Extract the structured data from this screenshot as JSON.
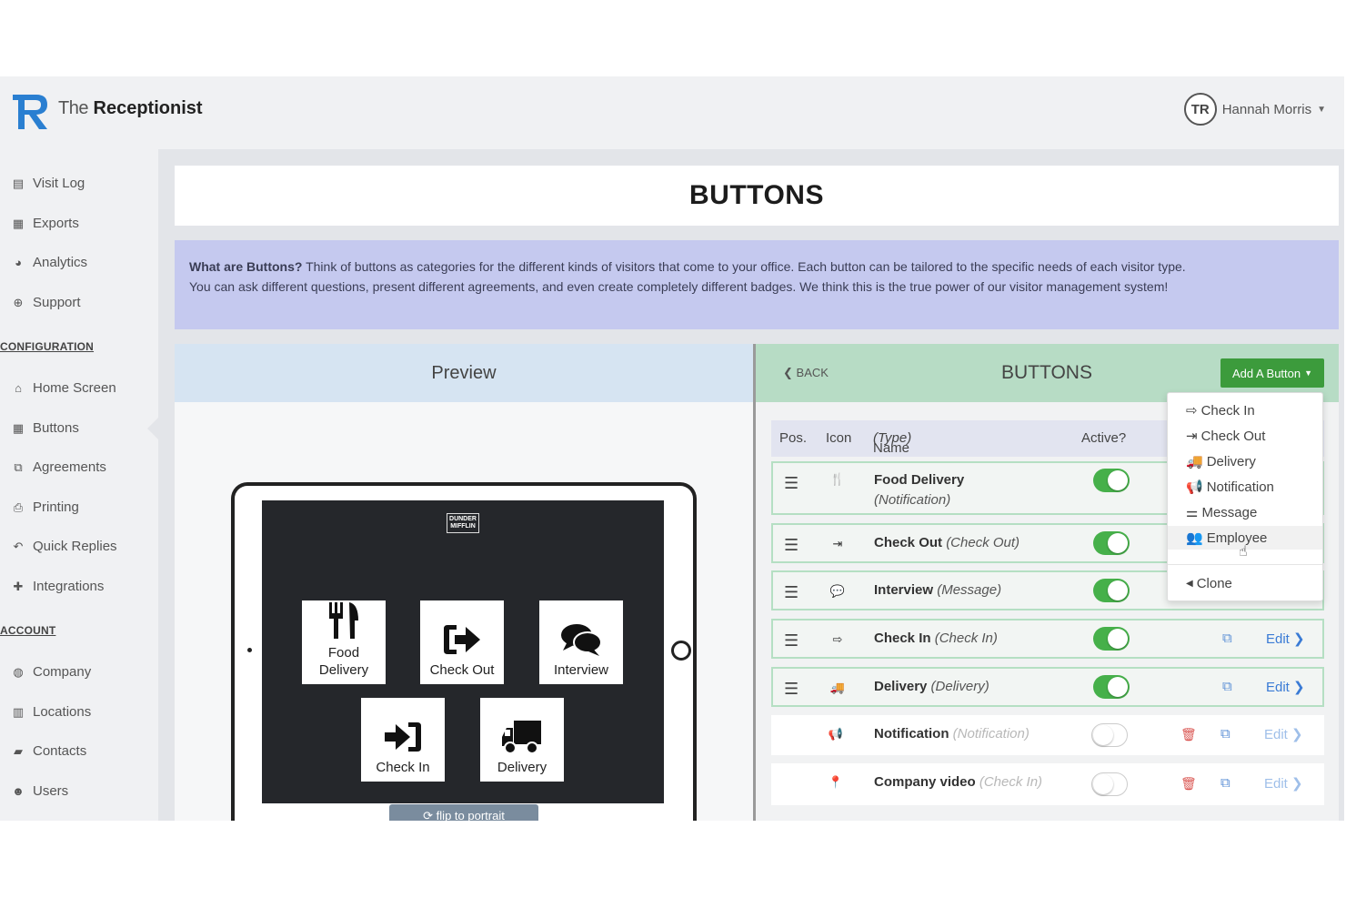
{
  "header": {
    "brand_the": "The",
    "brand_name": "Receptionist",
    "user_name": "Hannah Morris",
    "avatar_initials": "TR"
  },
  "sidebar": {
    "items_top": [
      {
        "label": "Visit Log",
        "icon": "file-icon",
        "glyph": "▤"
      },
      {
        "label": "Exports",
        "icon": "calendar-icon",
        "glyph": "▦"
      },
      {
        "label": "Analytics",
        "icon": "dashboard-icon",
        "glyph": "◕"
      },
      {
        "label": "Support",
        "icon": "lifebuoy-icon",
        "glyph": "⊕"
      }
    ],
    "section_config": "CONFIGURATION",
    "items_config": [
      {
        "label": "Home Screen",
        "icon": "home-icon",
        "glyph": "⌂"
      },
      {
        "label": "Buttons",
        "icon": "grid-icon",
        "glyph": "▦"
      },
      {
        "label": "Agreements",
        "icon": "agreement-icon",
        "glyph": "⧉"
      },
      {
        "label": "Printing",
        "icon": "print-icon",
        "glyph": "⎙"
      },
      {
        "label": "Quick Replies",
        "icon": "reply-icon",
        "glyph": "↶"
      },
      {
        "label": "Integrations",
        "icon": "puzzle-icon",
        "glyph": "✚"
      }
    ],
    "section_account": "ACCOUNT",
    "items_account": [
      {
        "label": "Company",
        "icon": "globe-icon",
        "glyph": "◍"
      },
      {
        "label": "Locations",
        "icon": "building-icon",
        "glyph": "▥"
      },
      {
        "label": "Contacts",
        "icon": "book-icon",
        "glyph": "▰"
      },
      {
        "label": "Users",
        "icon": "users-icon",
        "glyph": "☻"
      }
    ]
  },
  "page": {
    "title": "BUTTONS",
    "info_lead": "What are Buttons?",
    "info_text": " Think of buttons as categories for the different kinds of visitors that come to your office. Each button can be tailored to the specific needs of each visitor type. You can ask different questions, present different agreements, and even create completely different badges. We think this is the true power of our visitor management system!"
  },
  "preview": {
    "title": "Preview",
    "screen_logo": "DUNDER MIFFLIN",
    "tiles": {
      "food_line1": "Food",
      "food_line2": "Delivery",
      "checkout": "Check Out",
      "interview": "Interview",
      "checkin": "Check In",
      "delivery": "Delivery"
    },
    "flip_label": "⟳ flip to portrait"
  },
  "buttons_panel": {
    "back": "BACK",
    "title": "BUTTONS",
    "add_button": "Add A Button",
    "columns": {
      "pos": "Pos.",
      "icon": "Icon",
      "name": "Name",
      "type": "(Type)",
      "active": "Active?"
    },
    "rows": [
      {
        "name": "Food Delivery",
        "type": "(Notification)",
        "glyph": "🍴",
        "active": true
      },
      {
        "name": "Check Out",
        "type": "(Check Out)",
        "glyph": "⇥",
        "active": true
      },
      {
        "name": "Interview",
        "type": "(Message)",
        "glyph": "💬",
        "active": true
      },
      {
        "name": "Check In",
        "type": "(Check In)",
        "glyph": "⇨",
        "active": true
      },
      {
        "name": "Delivery",
        "type": "(Delivery)",
        "glyph": "🚚",
        "active": true
      },
      {
        "name": "Notification",
        "type": "(Notification)",
        "glyph": "📢",
        "active": false
      },
      {
        "name": "Company video",
        "type": "(Check In)",
        "glyph": "📍",
        "active": false
      }
    ],
    "edit_label": "Edit",
    "edit_chevron": "❯"
  },
  "dropdown": {
    "items": [
      {
        "label": "Check In",
        "glyph": "⇨",
        "icon": "sign-in-icon"
      },
      {
        "label": "Check Out",
        "glyph": "⇥",
        "icon": "sign-out-icon"
      },
      {
        "label": "Delivery",
        "glyph": "🚚",
        "icon": "truck-icon"
      },
      {
        "label": "Notification",
        "glyph": "📢",
        "icon": "bullhorn-icon"
      },
      {
        "label": "Message",
        "glyph": "⚌",
        "icon": "signpost-icon"
      },
      {
        "label": "Employee",
        "glyph": "👥",
        "icon": "users-icon"
      }
    ],
    "clone": "Clone"
  },
  "colors": {
    "accent_green": "#3c9b3c",
    "toggle_on": "#46b04a",
    "info_bg": "#c5c9ef",
    "preview_head": "#d6e4f2",
    "buttons_head": "#b7dcc5",
    "link_blue": "#3a7bd5",
    "delete_red": "#d9534f"
  }
}
